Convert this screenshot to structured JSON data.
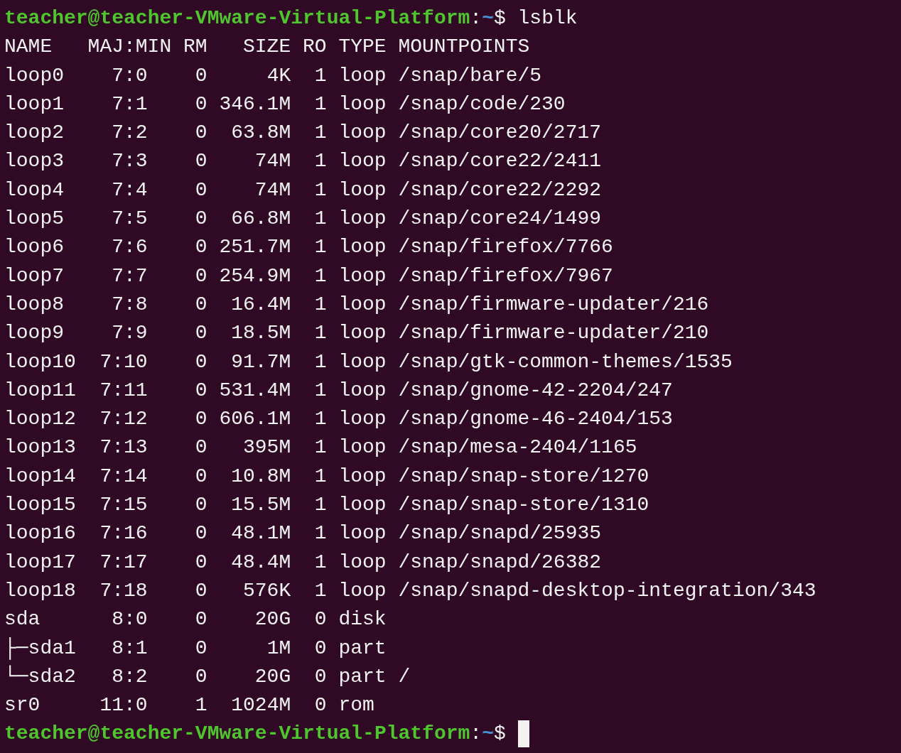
{
  "terminal": {
    "lines": [
      {
        "kind": "prompt",
        "user_host": "teacher@teacher-VMware-Virtual-Platform",
        "separator": ":",
        "path": "~",
        "symbol": "$",
        "command": "lsblk"
      },
      {
        "kind": "header",
        "cells": [
          "NAME",
          "MAJ:MIN",
          "RM",
          "SIZE",
          "RO",
          "TYPE",
          "MOUNTPOINTS"
        ]
      },
      {
        "kind": "row",
        "cells": [
          "loop0",
          "7:0",
          "0",
          "4K",
          "1",
          "loop",
          "/snap/bare/5"
        ]
      },
      {
        "kind": "row",
        "cells": [
          "loop1",
          "7:1",
          "0",
          "346.1M",
          "1",
          "loop",
          "/snap/code/230"
        ]
      },
      {
        "kind": "row",
        "cells": [
          "loop2",
          "7:2",
          "0",
          "63.8M",
          "1",
          "loop",
          "/snap/core20/2717"
        ]
      },
      {
        "kind": "row",
        "cells": [
          "loop3",
          "7:3",
          "0",
          "74M",
          "1",
          "loop",
          "/snap/core22/2411"
        ]
      },
      {
        "kind": "row",
        "cells": [
          "loop4",
          "7:4",
          "0",
          "74M",
          "1",
          "loop",
          "/snap/core22/2292"
        ]
      },
      {
        "kind": "row",
        "cells": [
          "loop5",
          "7:5",
          "0",
          "66.8M",
          "1",
          "loop",
          "/snap/core24/1499"
        ]
      },
      {
        "kind": "row",
        "cells": [
          "loop6",
          "7:6",
          "0",
          "251.7M",
          "1",
          "loop",
          "/snap/firefox/7766"
        ]
      },
      {
        "kind": "row",
        "cells": [
          "loop7",
          "7:7",
          "0",
          "254.9M",
          "1",
          "loop",
          "/snap/firefox/7967"
        ]
      },
      {
        "kind": "row",
        "cells": [
          "loop8",
          "7:8",
          "0",
          "16.4M",
          "1",
          "loop",
          "/snap/firmware-updater/216"
        ]
      },
      {
        "kind": "row",
        "cells": [
          "loop9",
          "7:9",
          "0",
          "18.5M",
          "1",
          "loop",
          "/snap/firmware-updater/210"
        ]
      },
      {
        "kind": "row",
        "cells": [
          "loop10",
          "7:10",
          "0",
          "91.7M",
          "1",
          "loop",
          "/snap/gtk-common-themes/1535"
        ]
      },
      {
        "kind": "row",
        "cells": [
          "loop11",
          "7:11",
          "0",
          "531.4M",
          "1",
          "loop",
          "/snap/gnome-42-2204/247"
        ]
      },
      {
        "kind": "row",
        "cells": [
          "loop12",
          "7:12",
          "0",
          "606.1M",
          "1",
          "loop",
          "/snap/gnome-46-2404/153"
        ]
      },
      {
        "kind": "row",
        "cells": [
          "loop13",
          "7:13",
          "0",
          "395M",
          "1",
          "loop",
          "/snap/mesa-2404/1165"
        ]
      },
      {
        "kind": "row",
        "cells": [
          "loop14",
          "7:14",
          "0",
          "10.8M",
          "1",
          "loop",
          "/snap/snap-store/1270"
        ]
      },
      {
        "kind": "row",
        "cells": [
          "loop15",
          "7:15",
          "0",
          "15.5M",
          "1",
          "loop",
          "/snap/snap-store/1310"
        ]
      },
      {
        "kind": "row",
        "cells": [
          "loop16",
          "7:16",
          "0",
          "48.1M",
          "1",
          "loop",
          "/snap/snapd/25935"
        ]
      },
      {
        "kind": "row",
        "cells": [
          "loop17",
          "7:17",
          "0",
          "48.4M",
          "1",
          "loop",
          "/snap/snapd/26382"
        ]
      },
      {
        "kind": "row",
        "cells": [
          "loop18",
          "7:18",
          "0",
          "576K",
          "1",
          "loop",
          "/snap/snapd-desktop-integration/343"
        ]
      },
      {
        "kind": "row",
        "cells": [
          "sda",
          "8:0",
          "0",
          "20G",
          "0",
          "disk"
        ]
      },
      {
        "kind": "row",
        "cells": [
          "├─sda1",
          "8:1",
          "0",
          "1M",
          "0",
          "part"
        ]
      },
      {
        "kind": "row",
        "cells": [
          "└─sda2",
          "8:2",
          "0",
          "20G",
          "0",
          "part",
          "/"
        ]
      },
      {
        "kind": "row",
        "cells": [
          "sr0",
          "11:0",
          "1",
          "1024M",
          "0",
          "rom"
        ]
      },
      {
        "kind": "prompt",
        "user_host": "teacher@teacher-VMware-Virtual-Platform",
        "separator": ":",
        "path": "~",
        "symbol": "$",
        "cursor": true
      }
    ]
  }
}
